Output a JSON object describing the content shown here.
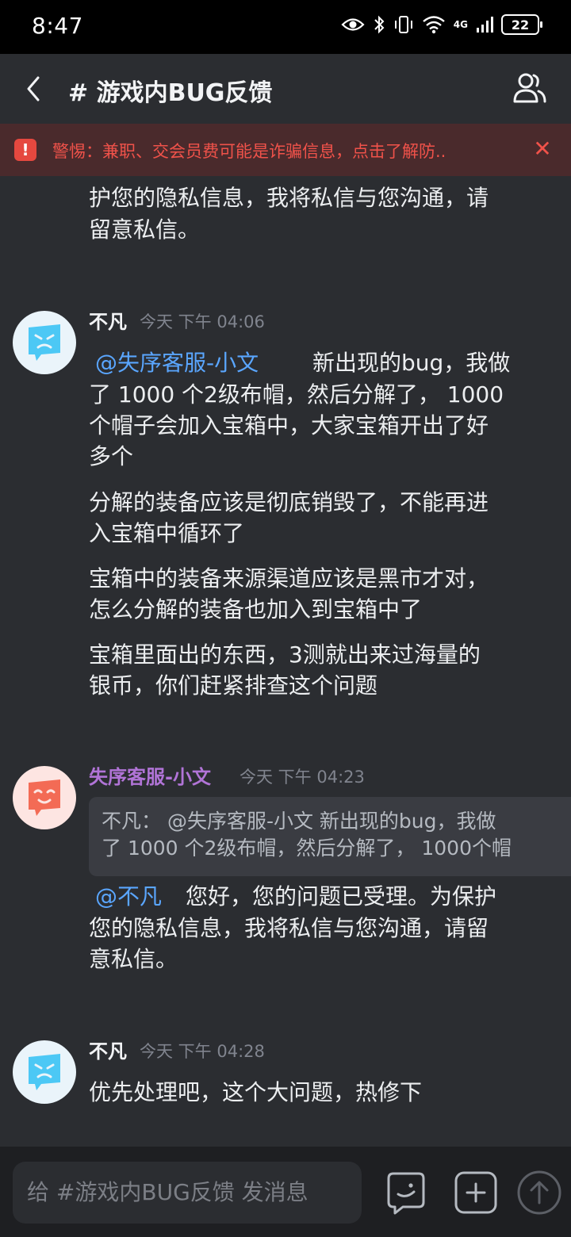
{
  "status": {
    "time": "8:47",
    "network": "4G",
    "battery": "22"
  },
  "header": {
    "title": "# 游戏内BUG反馈"
  },
  "warning": {
    "text": "警惕：兼职、交会员费可能是诈骗信息，点击了解防..",
    "close": "✕"
  },
  "messages": [
    {
      "lines": [
        "护您的隐私信息，我将私信与您沟通，请",
        "留意私信。"
      ]
    },
    {
      "user": "不凡",
      "time": "今天 下午 04:06",
      "mention": "@失序客服-小文",
      "lines": [
        "新出现的bug，我做",
        "了 1000 个2级布帽，然后分解了， 1000",
        "个帽子会加入宝箱中，大家宝箱开出了好",
        "多个"
      ],
      "paragraphs": [
        [
          "分解的装备应该是彻底销毁了，不能再进",
          "入宝箱中循环了"
        ],
        [
          "宝箱中的装备来源渠道应该是黑市才对，",
          "怎么分解的装备也加入到宝箱中了"
        ],
        [
          "宝箱里面出的东西，3测就出来过海量的",
          "银币，你们赶紧排查这个问题"
        ]
      ]
    },
    {
      "user": "失序客服-小文",
      "time": "今天 下午 04:23",
      "quote": [
        "不凡： @失序客服-小文 新出现的bug，我做",
        "了 1000 个2级布帽，然后分解了， 1000个帽"
      ],
      "mention": "@不凡",
      "lines": [
        "您好，您的问题已受理。为保护",
        "您的隐私信息，我将私信与您沟通，请留",
        "意私信。"
      ]
    },
    {
      "user": "不凡",
      "time": "今天 下午 04:28",
      "lines": [
        "优先处理吧，这个大问题，热修下"
      ]
    }
  ],
  "composer": {
    "placeholder": "给 #游戏内BUG反馈 发消息"
  },
  "icons": {
    "back": "chevron-left-icon",
    "members": "members-icon",
    "warning": "warning-icon",
    "close": "close-icon",
    "emoji": "emoji-icon",
    "add": "add-icon",
    "send": "send-icon"
  },
  "colors": {
    "background": "#2b2d31",
    "mention": "#5aa6ff",
    "warning": "#f0524a",
    "staff_name": "#b174d7"
  }
}
